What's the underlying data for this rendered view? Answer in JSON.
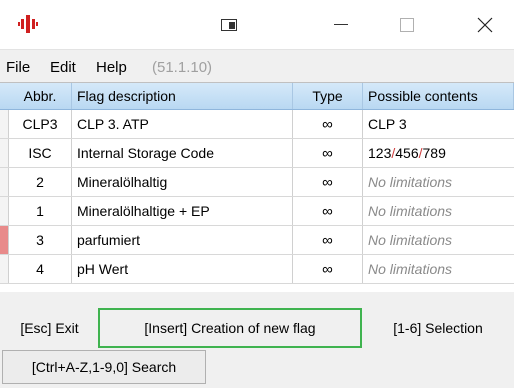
{
  "titlebar": {
    "icons": {
      "app": "app-logo-icon",
      "mode": "window-mode-icon",
      "minimize": "minimize-icon",
      "maximize": "maximize-icon",
      "close": "close-icon"
    },
    "brand_color": "#d02020"
  },
  "menu": {
    "file": "File",
    "edit": "Edit",
    "help": "Help",
    "version": "(51.1.10)"
  },
  "table": {
    "columns": [
      "Abbr.",
      "Flag description",
      "Type",
      "Possible contents"
    ],
    "rows": [
      {
        "abbr": "CLP3",
        "description": "CLP 3. ATP",
        "type": "∞",
        "contents": "CLP 3",
        "contents_muted": false
      },
      {
        "abbr": "ISC",
        "description": "Internal Storage Code",
        "type": "∞",
        "contents": "123/456/789",
        "contents_muted": false
      },
      {
        "abbr": "2",
        "description": "Mineralölhaltig",
        "type": "∞",
        "contents": "No limitations",
        "contents_muted": true
      },
      {
        "abbr": "1",
        "description": "Mineralölhaltige + EP",
        "type": "∞",
        "contents": "No limitations",
        "contents_muted": true
      },
      {
        "abbr": "3",
        "description": "parfumiert",
        "type": "∞",
        "contents": "No limitations",
        "contents_muted": true
      },
      {
        "abbr": "4",
        "description": "pH Wert",
        "type": "∞",
        "contents": "No limitations",
        "contents_muted": true
      }
    ],
    "active_row_marker_color": "#e88a8a"
  },
  "buttons": {
    "exit": "[Esc] Exit",
    "insert": "[Insert] Creation of new flag",
    "selection": "[1-6] Selection",
    "search": "[Ctrl+A-Z,1-9,0] Search",
    "highlight_color": "#3fb34f"
  }
}
